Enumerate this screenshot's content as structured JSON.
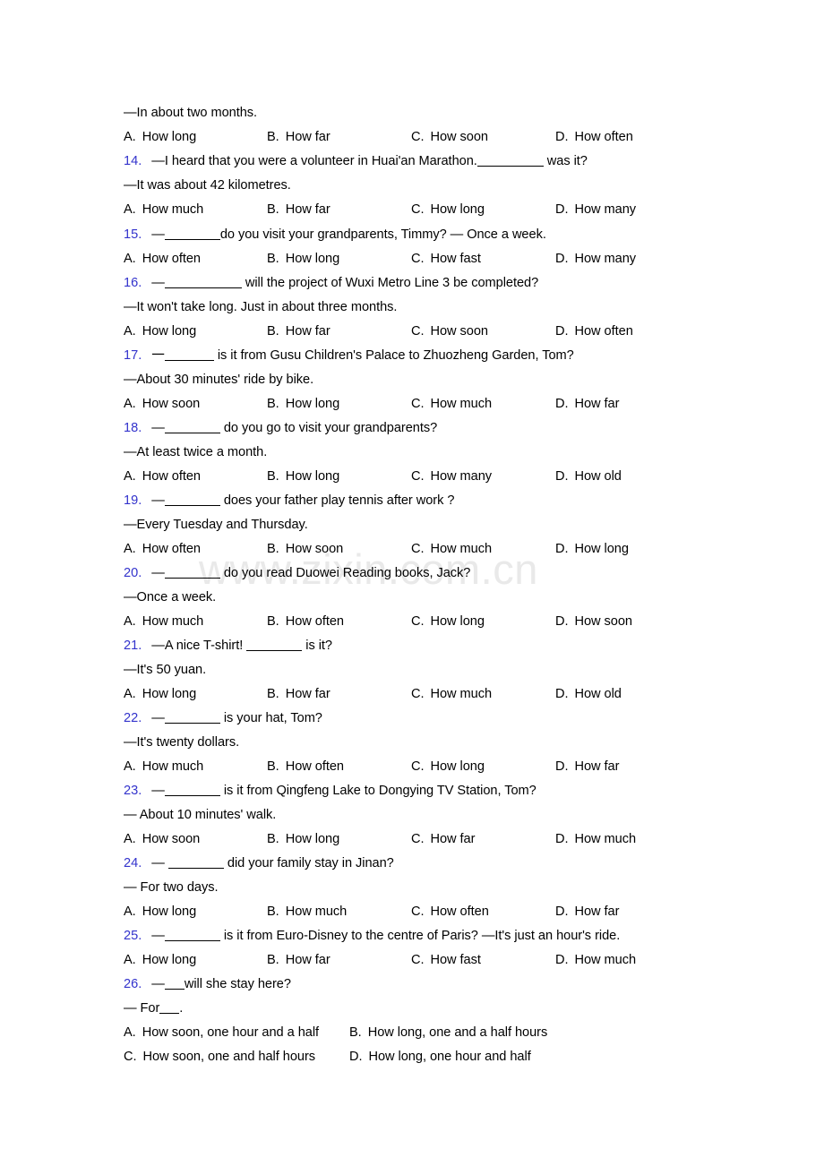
{
  "document": {
    "watermark": "www.zixin.com.cn",
    "accent_color": "#3333cc",
    "text_color": "#000000",
    "background_color": "#ffffff"
  },
  "lines": {
    "l01_answer": "—In about two months.",
    "q13_options": {
      "a": "A.",
      "a_text": "How long",
      "b": "B.",
      "b_text": "How far",
      "c": "C.",
      "c_text": "How soon",
      "d": "D.",
      "d_text": "How often"
    },
    "q14": {
      "num": "14.",
      "pre": "—I heard that you were a volunteer in Huai'an Marathon.",
      "post": "was it?"
    },
    "q14_answer": "—It was about 42 kilometres.",
    "q14_options": {
      "a": "A.",
      "a_text": "How much",
      "b": "B.",
      "b_text": "How far",
      "c": "C.",
      "c_text": "How long",
      "d": "D.",
      "d_text": "How many"
    },
    "q15": {
      "num": "15.",
      "pre": "—",
      "post": "do you visit your grandparents, Timmy? —  Once a week."
    },
    "q15_options": {
      "a": "A.",
      "a_text": "How often",
      "b": "B.",
      "b_text": "How long",
      "c": "C.",
      "c_text": "How fast",
      "d": "D.",
      "d_text": "How many"
    },
    "q16": {
      "num": "16.",
      "pre": "—",
      "post": "will the project of Wuxi Metro Line 3 be completed?"
    },
    "q16_answer": "—It won't take long. Just in about three months.",
    "q16_options": {
      "a": "A.",
      "a_text": "How long",
      "b": "B.",
      "b_text": "How far",
      "c": "C.",
      "c_text": "How soon",
      "d": "D.",
      "d_text": "How often"
    },
    "q17": {
      "num": "17.",
      "pre": "一",
      "post": "is it from Gusu Children's Palace to Zhuozheng Garden, Tom?"
    },
    "q17_answer": "—About 30 minutes' ride by bike.",
    "q17_options": {
      "a": "A.",
      "a_text": "How soon",
      "b": "B.",
      "b_text": "How long",
      "c": "C.",
      "c_text": "How much",
      "d": "D.",
      "d_text": "How far"
    },
    "q18": {
      "num": "18.",
      "pre": "—",
      "post": "do you go to visit your grandparents?"
    },
    "q18_answer": "—At least twice a month.",
    "q18_options": {
      "a": "A.",
      "a_text": "How often",
      "b": "B.",
      "b_text": "How long",
      "c": "C.",
      "c_text": "How many",
      "d": "D.",
      "d_text": "How old"
    },
    "q19": {
      "num": "19.",
      "pre": "—",
      "post": "does your father play tennis after work ?"
    },
    "q19_answer": "—Every Tuesday and Thursday.",
    "q19_options": {
      "a": "A.",
      "a_text": "How often",
      "b": "B.",
      "b_text": "How soon",
      "c": "C.",
      "c_text": "How much",
      "d": "D.",
      "d_text": "How long"
    },
    "q20": {
      "num": "20.",
      "pre": "—",
      "post": "do you read Duowei Reading books, Jack?"
    },
    "q20_answer": "—Once a week.",
    "q20_options": {
      "a": "A.",
      "a_text": "How much",
      "b": "B.",
      "b_text": "How often",
      "c": "C.",
      "c_text": "How long",
      "d": "D.",
      "d_text": "How soon"
    },
    "q21": {
      "num": "21.",
      "pre": "—A nice T-shirt!",
      "post": "is it?"
    },
    "q21_answer": "—It's 50 yuan.",
    "q21_options": {
      "a": "A.",
      "a_text": "How long",
      "b": "B.",
      "b_text": "How far",
      "c": "C.",
      "c_text": "How much",
      "d": "D.",
      "d_text": "How old"
    },
    "q22": {
      "num": "22.",
      "pre": "—",
      "post": "is your hat, Tom?"
    },
    "q22_answer": "—It's twenty dollars.",
    "q22_options": {
      "a": "A.",
      "a_text": "How much",
      "b": "B.",
      "b_text": "How often",
      "c": "C.",
      "c_text": "How long",
      "d": "D.",
      "d_text": "How far"
    },
    "q23": {
      "num": "23.",
      "pre": "—",
      "post": "is it from Qingfeng Lake to Dongying TV Station, Tom?"
    },
    "q23_answer": "— About 10 minutes' walk.",
    "q23_options": {
      "a": "A.",
      "a_text": "How soon",
      "b": "B.",
      "b_text": "How long",
      "c": "C.",
      "c_text": "How far",
      "d": "D.",
      "d_text": "How much"
    },
    "q24": {
      "num": "24.",
      "pre": "—",
      "post": "did your family stay in Jinan?"
    },
    "q24_answer": "— For two days.",
    "q24_options": {
      "a": "A.",
      "a_text": "How long",
      "b": "B.",
      "b_text": "How much",
      "c": "C.",
      "c_text": "How often",
      "d": "D.",
      "d_text": "How far"
    },
    "q25": {
      "num": "25.",
      "pre": "—",
      "post": "is it from Euro-Disney to the centre of Paris?  —It's just an hour's ride."
    },
    "q25_options": {
      "a": "A.",
      "a_text": "How long",
      "b": "B.",
      "b_text": "How far",
      "c": "C.",
      "c_text": "How fast",
      "d": "D.",
      "d_text": "How much"
    },
    "q26": {
      "num": "26.",
      "pre": "—",
      "post": "will she stay here?"
    },
    "q26_answer_pre": "— For",
    "q26_answer_post": ".",
    "q26_options_row1": {
      "a": "A.",
      "a_text": "How soon, one hour and a half",
      "b": "B.",
      "b_text": "How long, one and a half hours"
    },
    "q26_options_row2": {
      "c": "C.",
      "c_text": "How soon, one and half hours",
      "d": "D.",
      "d_text": "How long, one hour and half"
    }
  }
}
